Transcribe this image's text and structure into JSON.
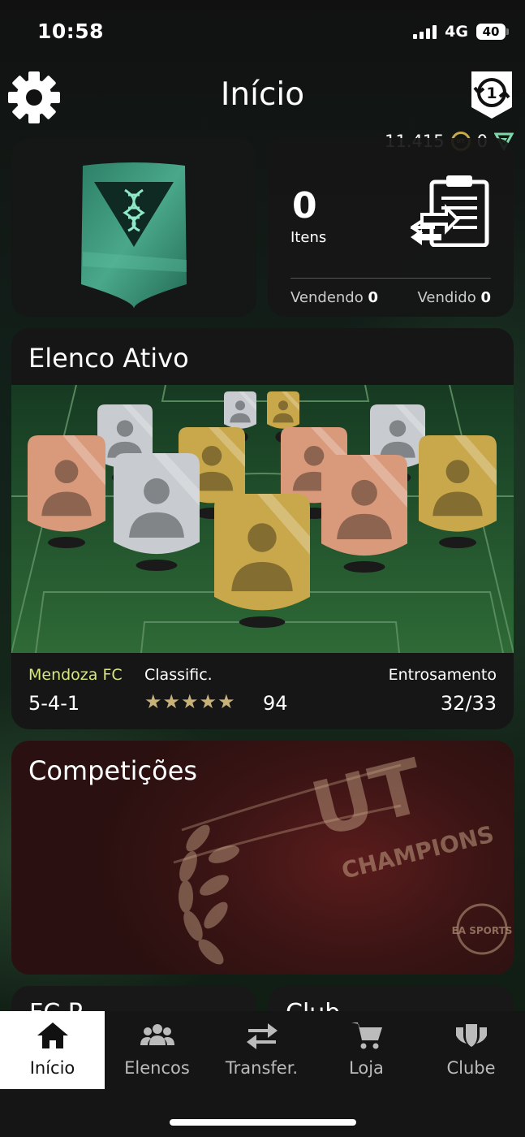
{
  "status_bar": {
    "time": "10:58",
    "network": "4G",
    "battery": "40"
  },
  "header": {
    "title": "Início",
    "coins": "11.415",
    "coin_icon_text": "UT",
    "points": "0"
  },
  "evolutions": {
    "icon": "dna-icon"
  },
  "transfer_list": {
    "count": "0",
    "label": "Itens",
    "selling_label": "Vendendo",
    "selling_count": "0",
    "sold_label": "Vendido",
    "sold_count": "0"
  },
  "squad": {
    "title": "Elenco Ativo",
    "club_name": "Mendoza FC",
    "formation": "5-4-1",
    "rating_label": "Classific.",
    "stars": "★★★★★",
    "star_count": 5,
    "rating": "94",
    "chemistry_label": "Entrosamento",
    "chemistry": "32/33"
  },
  "competitions": {
    "title": "Competições",
    "art_text_1": "UT",
    "art_text_2": "CHAMPIONS",
    "art_text_3": "EA SPORTS"
  },
  "peek": {
    "left_title": "FC P",
    "right_title": "Club"
  },
  "nav": {
    "items": [
      {
        "label": "Início",
        "icon": "home-icon",
        "active": true
      },
      {
        "label": "Elencos",
        "icon": "squads-icon",
        "active": false
      },
      {
        "label": "Transfer.",
        "icon": "transfer-icon",
        "active": false
      },
      {
        "label": "Loja",
        "icon": "cart-icon",
        "active": false
      },
      {
        "label": "Clube",
        "icon": "club-icon",
        "active": false
      }
    ]
  },
  "colors": {
    "accent_club": "#d9e87a",
    "gold": "#c9a84c",
    "silver": "#c8ccd0",
    "bronze": "#d99a7c",
    "evo_green": "#3b9a7a",
    "comp_red": "#4a1616"
  }
}
